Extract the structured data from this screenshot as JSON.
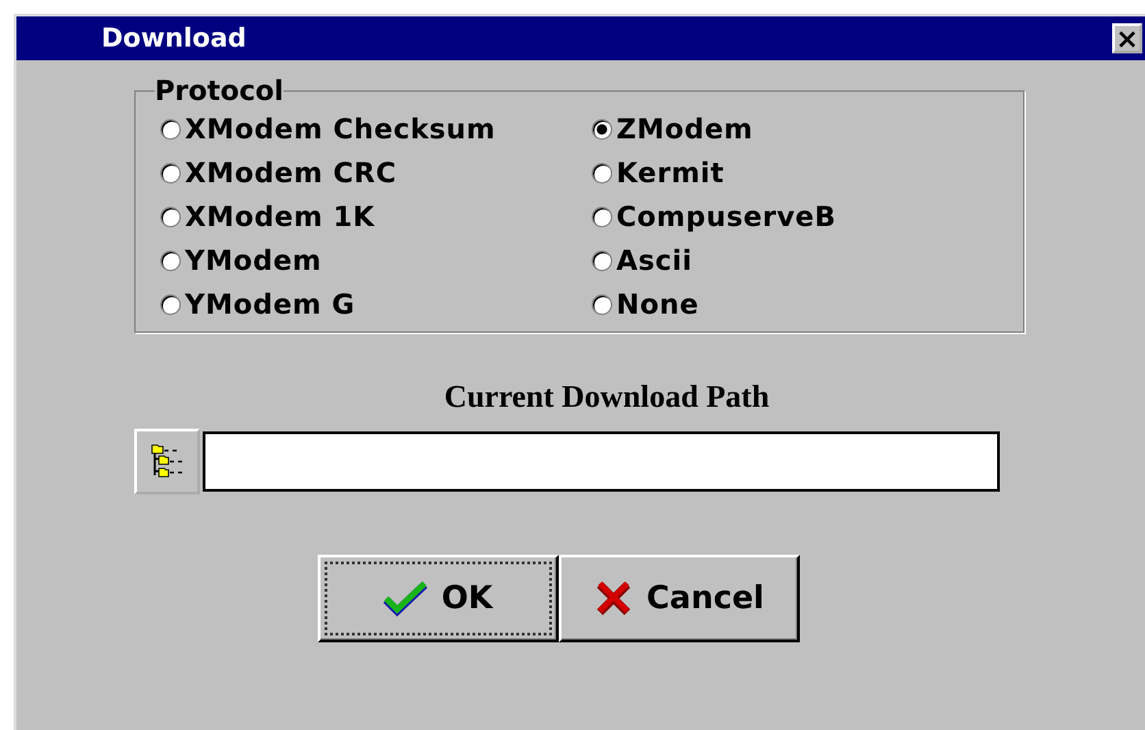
{
  "window": {
    "title": "Download",
    "close": "×"
  },
  "protocol": {
    "legend": "Protocol",
    "options": [
      {
        "label": "XModem Checksum",
        "selected": false
      },
      {
        "label": "XModem CRC",
        "selected": false
      },
      {
        "label": "XModem 1K",
        "selected": false
      },
      {
        "label": "YModem",
        "selected": false
      },
      {
        "label": "YModem G",
        "selected": false
      },
      {
        "label": "ZModem",
        "selected": true
      },
      {
        "label": "Kermit",
        "selected": false
      },
      {
        "label": "CompuserveB",
        "selected": false
      },
      {
        "label": "Ascii",
        "selected": false
      },
      {
        "label": "None",
        "selected": false
      }
    ]
  },
  "path": {
    "label": "Current Download Path"
  },
  "buttons": [
    {
      "label": "OK",
      "kind": "ok",
      "focused": true
    },
    {
      "label": "Cancel",
      "kind": "cancel",
      "focused": false
    }
  ]
}
